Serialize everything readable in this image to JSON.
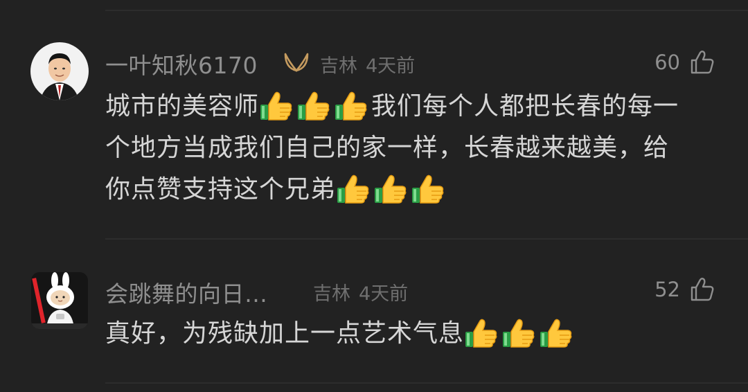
{
  "comments": [
    {
      "author": "一叶知秋6170",
      "location": "吉林",
      "time": "4天前",
      "likes": "60",
      "text": "城市的美容师👍👍👍我们每个人都把长春的每一个地方当成我们自己的家一样，长春越来越美，给你点赞支持这个兄弟👍👍👍",
      "text_line1_part1": "城市的美容师",
      "text_line1_part2": "我们每个人都把长春的每一",
      "text_line2": "个地方当成我们自己的家一样，长春越来越美，给",
      "text_line3": "你点赞支持这个兄弟",
      "avatar_icon": "person-avatar-icon",
      "badge_icon": "vip-badge-icon"
    },
    {
      "author": "会跳舞的向日…",
      "location": "吉林",
      "time": "4天前",
      "likes": "52",
      "text": "真好，为残缺加上一点艺术气息👍👍👍",
      "avatar_icon": "rabbit-avatar-icon"
    }
  ],
  "colors": {
    "background": "#222222",
    "name": "#8f8f8f",
    "meta": "#6f6f6f",
    "text": "#d6d6d6",
    "badge": "#c59b5f"
  }
}
